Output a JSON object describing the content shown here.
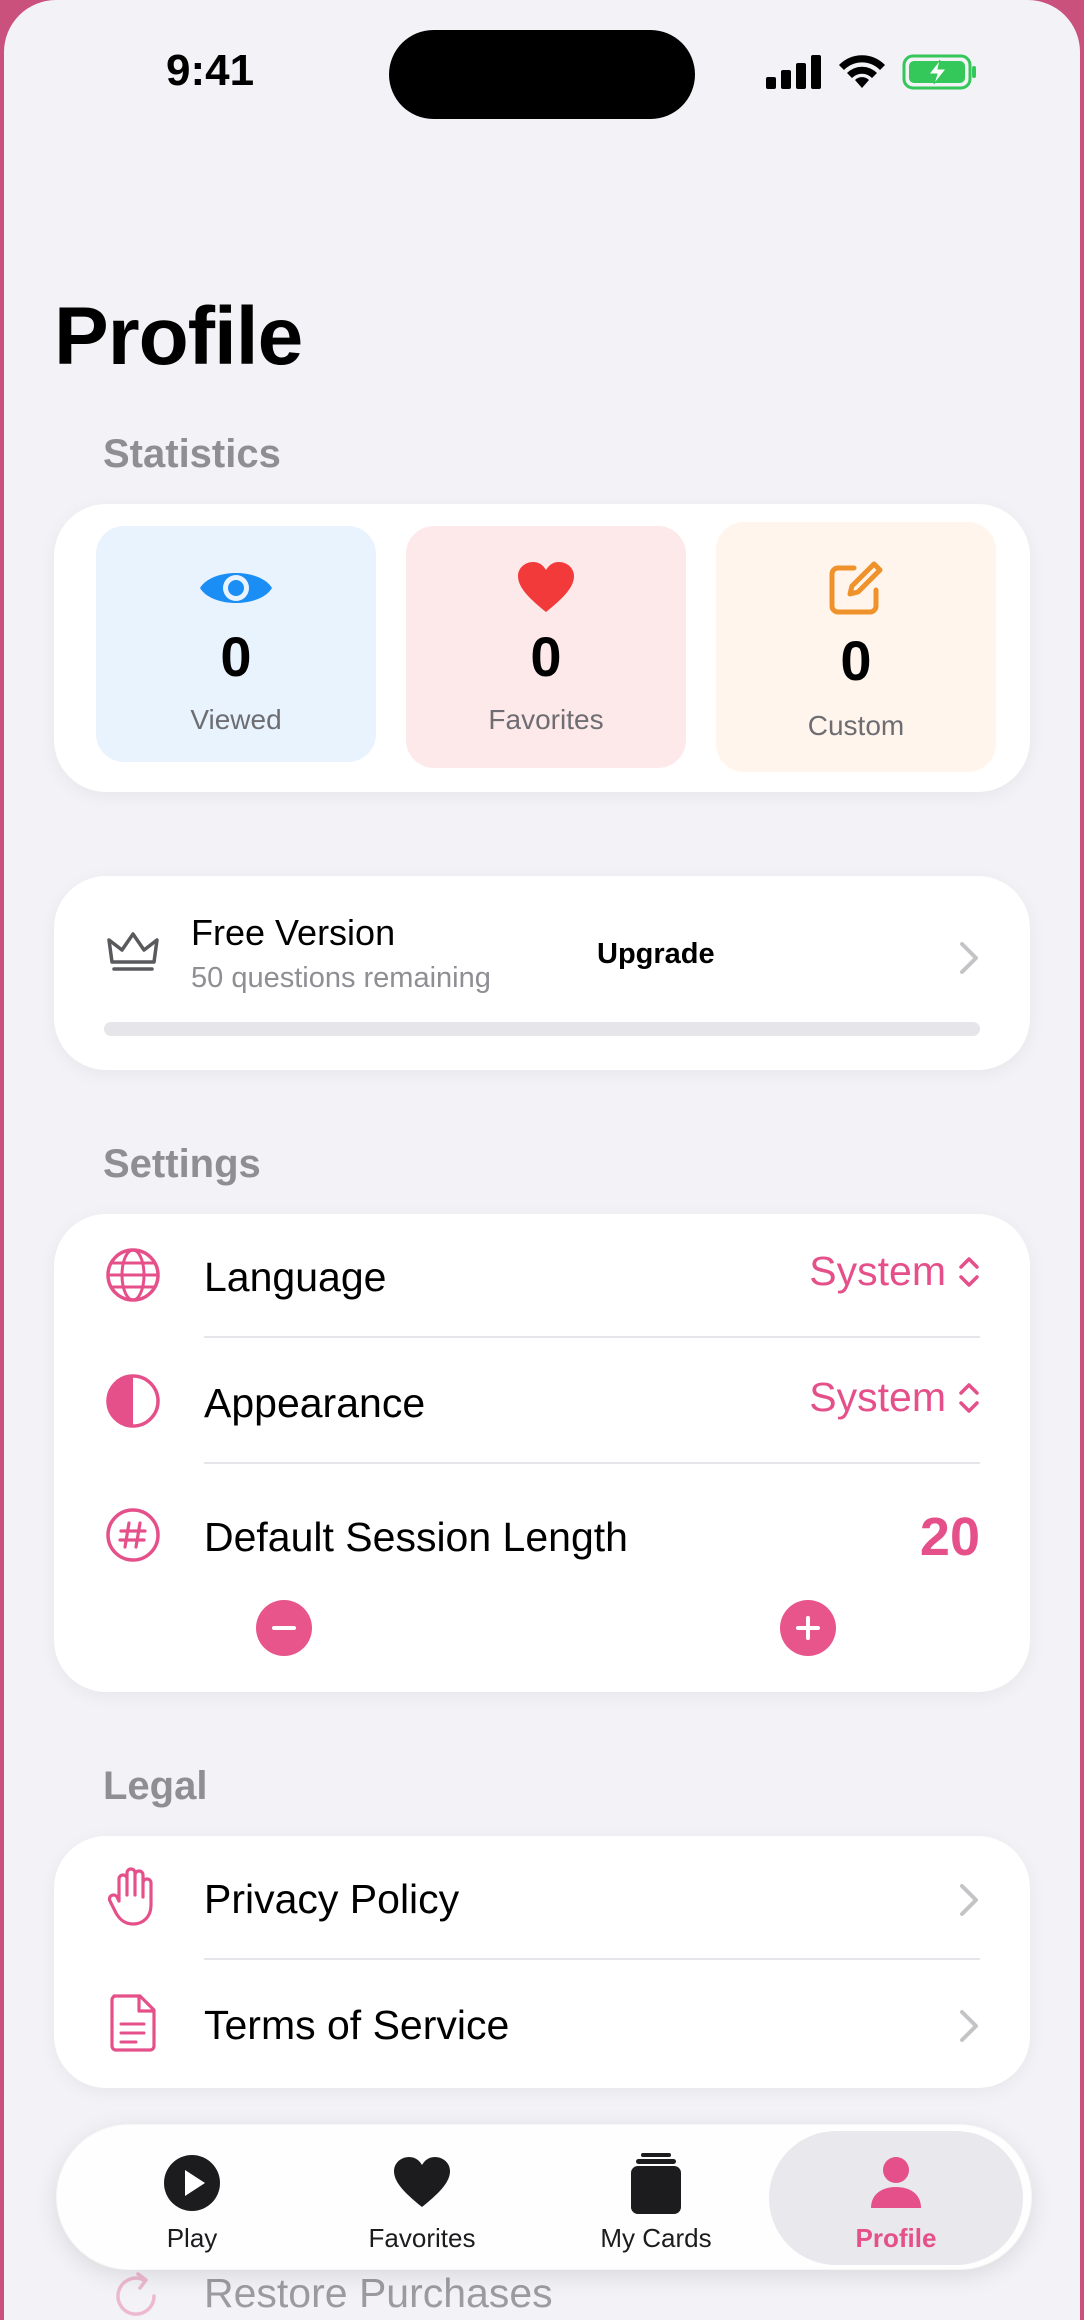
{
  "status_bar": {
    "time": "9:41"
  },
  "page_title": "Profile",
  "statistics": {
    "header": "Statistics",
    "tiles": [
      {
        "icon": "eye-icon",
        "value": "0",
        "label": "Viewed",
        "bg": "#e8f3fe",
        "icon_color": "#1a8ef5"
      },
      {
        "icon": "heart-icon",
        "value": "0",
        "label": "Favorites",
        "bg": "#fde9ea",
        "icon_color": "#f23a3a"
      },
      {
        "icon": "square-pencil-icon",
        "value": "0",
        "label": "Custom",
        "bg": "#fff5ec",
        "icon_color": "#f0922c"
      }
    ]
  },
  "free_version": {
    "icon": "crown-icon",
    "title": "Free Version",
    "subtitle": "50 questions remaining",
    "upgrade_label": "Upgrade",
    "progress": 0
  },
  "settings": {
    "header": "Settings",
    "language": {
      "label": "Language",
      "value": "System",
      "icon": "globe-icon"
    },
    "appearance": {
      "label": "Appearance",
      "value": "System",
      "icon": "contrast-icon"
    },
    "session_length": {
      "label": "Default Session Length",
      "value": "20",
      "icon": "number-icon"
    }
  },
  "legal": {
    "header": "Legal",
    "privacy": {
      "label": "Privacy Policy",
      "icon": "hand-icon"
    },
    "terms": {
      "label": "Terms of Service",
      "icon": "document-icon"
    }
  },
  "restore_purchases": {
    "label": "Restore Purchases",
    "icon": "refresh-icon"
  },
  "tabbar": {
    "tabs": [
      {
        "label": "Play",
        "icon": "play-icon"
      },
      {
        "label": "Favorites",
        "icon": "heart-icon"
      },
      {
        "label": "My Cards",
        "icon": "cards-icon"
      },
      {
        "label": "Profile",
        "icon": "person-icon",
        "active": true
      }
    ]
  },
  "colors": {
    "accent": "#e5508a",
    "background": "#f2f2f7",
    "card": "#ffffff",
    "secondary_text": "#8e8e93"
  }
}
